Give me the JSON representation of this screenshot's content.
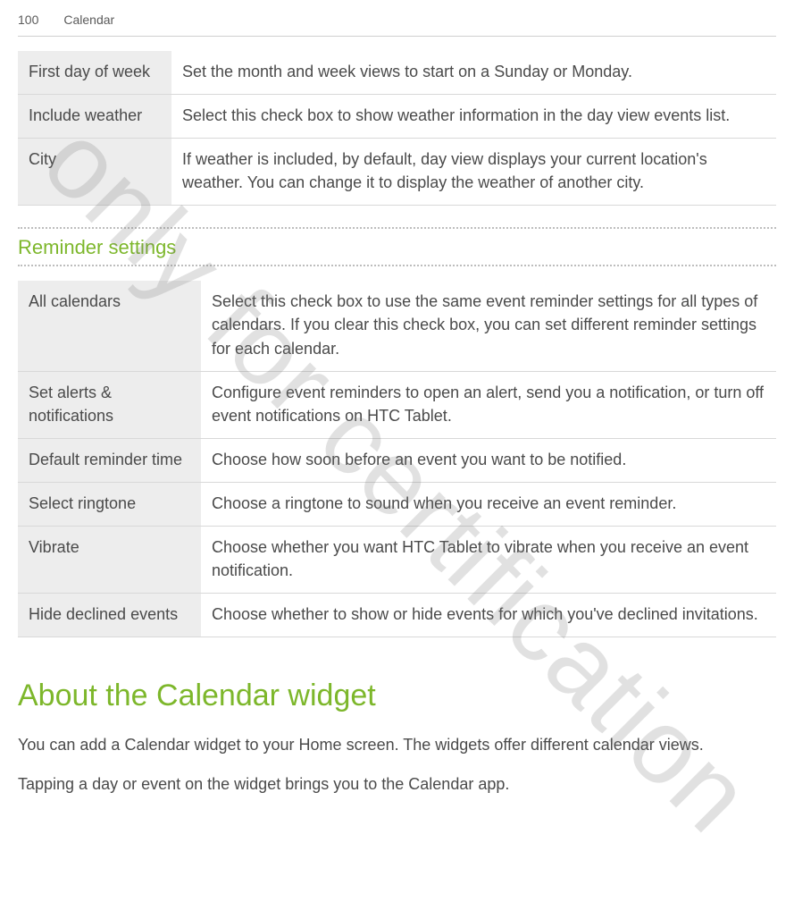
{
  "header": {
    "page_number": "100",
    "chapter": "Calendar"
  },
  "table1": {
    "rows": [
      {
        "label": "First day of week",
        "desc": "Set the month and week views to start on a Sunday or Monday."
      },
      {
        "label": "Include weather",
        "desc": "Select this check box to show weather information in the day view events list."
      },
      {
        "label": "City",
        "desc": "If weather is included, by default, day view displays your current location's weather. You can change it to display the weather of another city."
      }
    ]
  },
  "section_reminder": {
    "heading": "Reminder settings"
  },
  "table2": {
    "rows": [
      {
        "label": "All calendars",
        "desc": "Select this check box to use the same event reminder settings for all types of calendars. If you clear this check box, you can set different reminder settings for each calendar."
      },
      {
        "label": "Set alerts & notifications",
        "desc": "Configure event reminders to open an alert, send you a notification, or turn off event notifications on HTC Tablet."
      },
      {
        "label": "Default reminder time",
        "desc": "Choose how soon before an event you want to be notified."
      },
      {
        "label": "Select ringtone",
        "desc": "Choose a ringtone to sound when you receive an event reminder."
      },
      {
        "label": "Vibrate",
        "desc": "Choose whether you want HTC Tablet to vibrate when you receive an event notification."
      },
      {
        "label": "Hide declined events",
        "desc": "Choose whether to show or hide events for which you've declined invitations."
      }
    ]
  },
  "widget_section": {
    "heading": "About the Calendar widget",
    "para1": "You can add a Calendar widget to your Home screen. The widgets offer different calendar views.",
    "para2": "Tapping a day or event on the widget brings you to the Calendar app."
  },
  "watermark": "only for certification"
}
